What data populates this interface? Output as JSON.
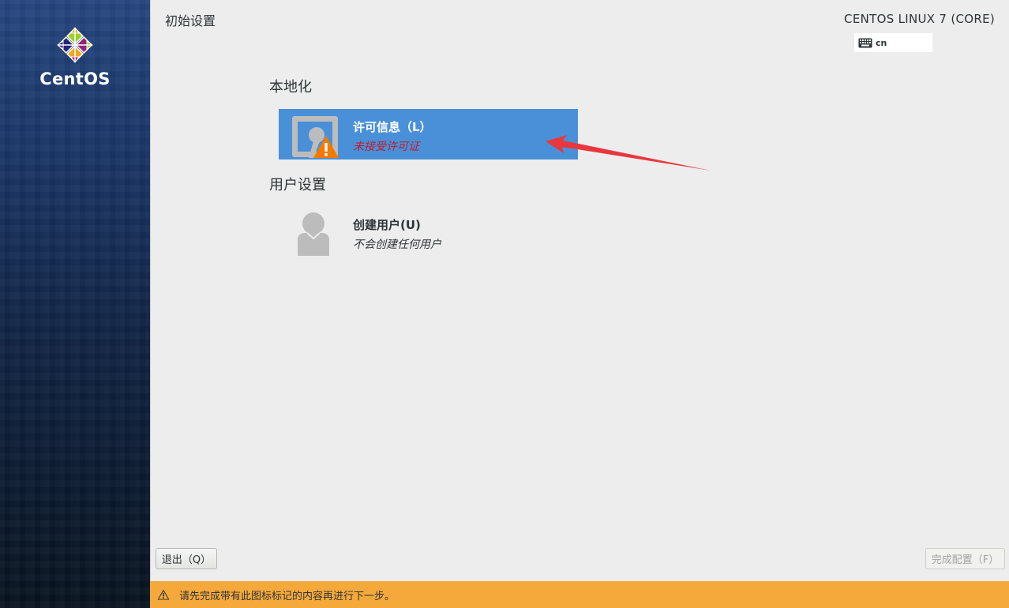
{
  "header": {
    "page_title": "初始设置",
    "os_title": "CENTOS LINUX 7 (CORE)",
    "keyboard_layout": "cn"
  },
  "sidebar": {
    "logo_text": "CentOS"
  },
  "sections": [
    {
      "title": "本地化",
      "spokes": [
        {
          "name": "许可信息（L）",
          "status": "未接受许可证",
          "status_type": "warning",
          "icon": "license-document-icon",
          "selected": true
        }
      ]
    },
    {
      "title": "用户设置",
      "spokes": [
        {
          "name": "创建用户(U)",
          "status": "不会创建任何用户",
          "status_type": "normal",
          "icon": "user-avatar-icon",
          "selected": false
        }
      ]
    }
  ],
  "footer": {
    "quit_label": "退出（Q）",
    "finish_label": "完成配置（F）",
    "finish_enabled": false
  },
  "warning_bar": {
    "text": "请先完成带有此图标标记的内容再进行下一步。"
  },
  "colors": {
    "selected_spoke": "#4a90d9",
    "warning_bar": "#f6a93b",
    "warning_text": "#c01c28",
    "annotation_arrow": "#e8383d",
    "warning_triangle": "#f57900"
  }
}
